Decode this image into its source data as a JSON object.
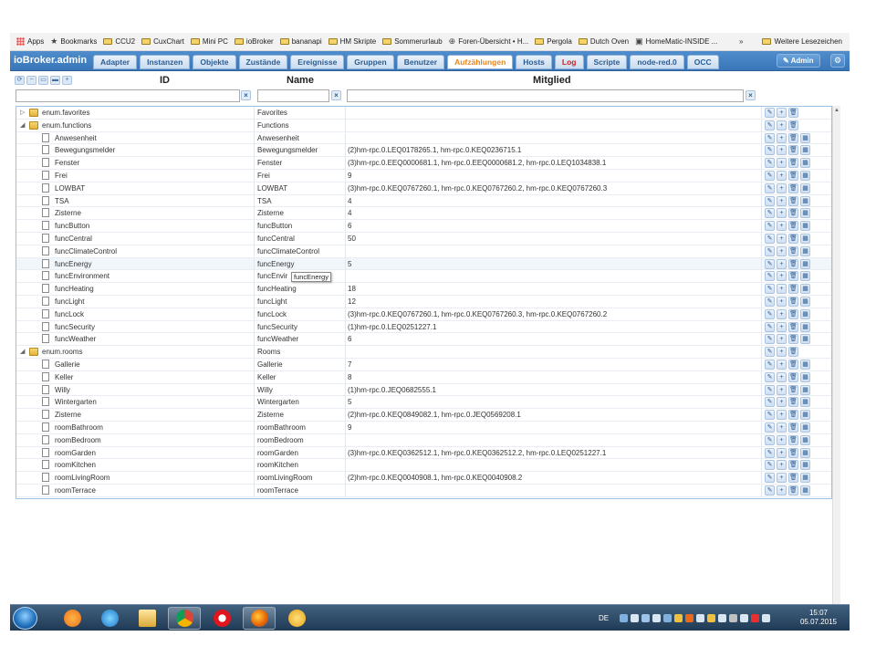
{
  "bookmarks_bar": {
    "items": [
      {
        "label": "Apps",
        "icon": "apps-grid-icon"
      },
      {
        "label": "Bookmarks",
        "icon": "star-icon"
      },
      {
        "label": "CCU2",
        "icon": "folder-icon"
      },
      {
        "label": "CuxChart",
        "icon": "folder-icon"
      },
      {
        "label": "Mini PC",
        "icon": "folder-icon"
      },
      {
        "label": "ioBroker",
        "icon": "folder-icon"
      },
      {
        "label": "bananapi",
        "icon": "folder-icon"
      },
      {
        "label": "HM Skripte",
        "icon": "folder-icon"
      },
      {
        "label": "Sommerurlaub",
        "icon": "folder-icon"
      },
      {
        "label": "Foren-Übersicht • H...",
        "icon": "globe-icon"
      },
      {
        "label": "Pergola",
        "icon": "folder-icon"
      },
      {
        "label": "Dutch Oven",
        "icon": "folder-icon"
      },
      {
        "label": "HomeMatic-INSIDE ...",
        "icon": "page-icon"
      }
    ],
    "overflow": "»",
    "other": "Weitere Lesezeichen"
  },
  "app": {
    "brand": "ioBroker.admin",
    "tabs": [
      {
        "label": "Adapter",
        "state": "normal"
      },
      {
        "label": "Instanzen",
        "state": "normal"
      },
      {
        "label": "Objekte",
        "state": "normal"
      },
      {
        "label": "Zustände",
        "state": "normal"
      },
      {
        "label": "Ereignisse",
        "state": "normal"
      },
      {
        "label": "Gruppen",
        "state": "normal"
      },
      {
        "label": "Benutzer",
        "state": "normal"
      },
      {
        "label": "Aufzählungen",
        "state": "active"
      },
      {
        "label": "Hosts",
        "state": "normal"
      },
      {
        "label": "Log",
        "state": "log"
      },
      {
        "label": "Scripte",
        "state": "normal"
      },
      {
        "label": "node-red.0",
        "state": "normal"
      },
      {
        "label": "OCC",
        "state": "normal"
      }
    ],
    "admin_label": "Admin",
    "colors": {
      "accent": "#3a76b8",
      "active_tab_text": "#e8861c",
      "log_text": "#cc2222"
    }
  },
  "grid": {
    "toolbar_icons": [
      "refresh-icon",
      "collapse-icon",
      "folder-open-icon",
      "folder-closed-icon",
      "add-icon"
    ],
    "columns": {
      "id": "ID",
      "name": "Name",
      "members": "Mitglied"
    },
    "filters": {
      "id": "",
      "name": "",
      "members": ""
    },
    "clear_glyph": "×",
    "action_glyphs": {
      "edit": "✎",
      "add": "+",
      "delete": "🗑",
      "members": "▦"
    },
    "rows": [
      {
        "id": "enum.favorites",
        "name": "Favorites",
        "members": "",
        "level": 0,
        "folder": true,
        "expanded": false
      },
      {
        "id": "enum.functions",
        "name": "Functions",
        "members": "",
        "level": 0,
        "folder": true,
        "expanded": true
      },
      {
        "id": "Anwesenheit",
        "name": "Anwesenheit",
        "members": "",
        "level": 1,
        "folder": false
      },
      {
        "id": "Bewegungsmelder",
        "name": "Bewegungsmelder",
        "members": "(2)hm-rpc.0.LEQ0178265.1, hm-rpc.0.KEQ0236715.1",
        "level": 1,
        "folder": false
      },
      {
        "id": "Fenster",
        "name": "Fenster",
        "members": "(3)hm-rpc.0.EEQ0000681.1, hm-rpc.0.EEQ0000681.2, hm-rpc.0.LEQ1034838.1",
        "level": 1,
        "folder": false
      },
      {
        "id": "Frei",
        "name": "Frei",
        "members": "9",
        "level": 1,
        "folder": false
      },
      {
        "id": "LOWBAT",
        "name": "LOWBAT",
        "members": "(3)hm-rpc.0.KEQ0767260.1, hm-rpc.0.KEQ0767260.2, hm-rpc.0.KEQ0767260.3",
        "level": 1,
        "folder": false
      },
      {
        "id": "TSA",
        "name": "TSA",
        "members": "4",
        "level": 1,
        "folder": false
      },
      {
        "id": "Zisterne",
        "name": "Zisterne",
        "members": "4",
        "level": 1,
        "folder": false
      },
      {
        "id": "funcButton",
        "name": "funcButton",
        "members": "6",
        "level": 1,
        "folder": false
      },
      {
        "id": "funcCentral",
        "name": "funcCentral",
        "members": "50",
        "level": 1,
        "folder": false
      },
      {
        "id": "funcClimateControl",
        "name": "funcClimateControl",
        "members": "",
        "level": 1,
        "folder": false
      },
      {
        "id": "funcEnergy",
        "name": "funcEnergy",
        "members": "5",
        "level": 1,
        "folder": false,
        "highlight": true
      },
      {
        "id": "funcEnvironment",
        "name": "funcEnvir",
        "members": "",
        "level": 1,
        "folder": false
      },
      {
        "id": "funcHeating",
        "name": "funcHeating",
        "members": "18",
        "level": 1,
        "folder": false
      },
      {
        "id": "funcLight",
        "name": "funcLight",
        "members": "12",
        "level": 1,
        "folder": false
      },
      {
        "id": "funcLock",
        "name": "funcLock",
        "members": "(3)hm-rpc.0.KEQ0767260.1, hm-rpc.0.KEQ0767260.3, hm-rpc.0.KEQ0767260.2",
        "level": 1,
        "folder": false
      },
      {
        "id": "funcSecurity",
        "name": "funcSecurity",
        "members": "(1)hm-rpc.0.LEQ0251227.1",
        "level": 1,
        "folder": false
      },
      {
        "id": "funcWeather",
        "name": "funcWeather",
        "members": "6",
        "level": 1,
        "folder": false
      },
      {
        "id": "enum.rooms",
        "name": "Rooms",
        "members": "",
        "level": 0,
        "folder": true,
        "expanded": true
      },
      {
        "id": "Gallerie",
        "name": "Gallerie",
        "members": "7",
        "level": 1,
        "folder": false
      },
      {
        "id": "Keller",
        "name": "Keller",
        "members": "8",
        "level": 1,
        "folder": false
      },
      {
        "id": "Willy",
        "name": "Willy",
        "members": "(1)hm-rpc.0.JEQ0682555.1",
        "level": 1,
        "folder": false
      },
      {
        "id": "Wintergarten",
        "name": "Wintergarten",
        "members": "5",
        "level": 1,
        "folder": false
      },
      {
        "id": "Zisterne",
        "name": "Zisterne",
        "members": "(2)hm-rpc.0.KEQ0849082.1, hm-rpc.0.JEQ0569208.1",
        "level": 1,
        "folder": false
      },
      {
        "id": "roomBathroom",
        "name": "roomBathroom",
        "members": "9",
        "level": 1,
        "folder": false
      },
      {
        "id": "roomBedroom",
        "name": "roomBedroom",
        "members": "",
        "level": 1,
        "folder": false
      },
      {
        "id": "roomGarden",
        "name": "roomGarden",
        "members": "(3)hm-rpc.0.KEQ0362512.1, hm-rpc.0.KEQ0362512.2, hm-rpc.0.LEQ0251227.1",
        "level": 1,
        "folder": false
      },
      {
        "id": "roomKitchen",
        "name": "roomKitchen",
        "members": "",
        "level": 1,
        "folder": false
      },
      {
        "id": "roomLivingRoom",
        "name": "roomLivingRoom",
        "members": "(2)hm-rpc.0.KEQ0040908.1, hm-rpc.0.KEQ0040908.2",
        "level": 1,
        "folder": false
      },
      {
        "id": "roomTerrace",
        "name": "roomTerrace",
        "members": "",
        "level": 1,
        "folder": false
      }
    ]
  },
  "tooltip": "funcEnergy",
  "taskbar": {
    "apps": [
      {
        "icon": "media-player-icon",
        "pinned": false
      },
      {
        "icon": "internet-explorer-icon",
        "pinned": false
      },
      {
        "icon": "file-explorer-icon",
        "pinned": false
      },
      {
        "icon": "chrome-icon",
        "pinned": true
      },
      {
        "icon": "opera-icon",
        "pinned": false
      },
      {
        "icon": "firefox-icon",
        "pinned": true
      },
      {
        "icon": "paint-icon",
        "pinned": false
      }
    ],
    "language": "DE",
    "time": "15:07",
    "date": "05.07.2015"
  }
}
